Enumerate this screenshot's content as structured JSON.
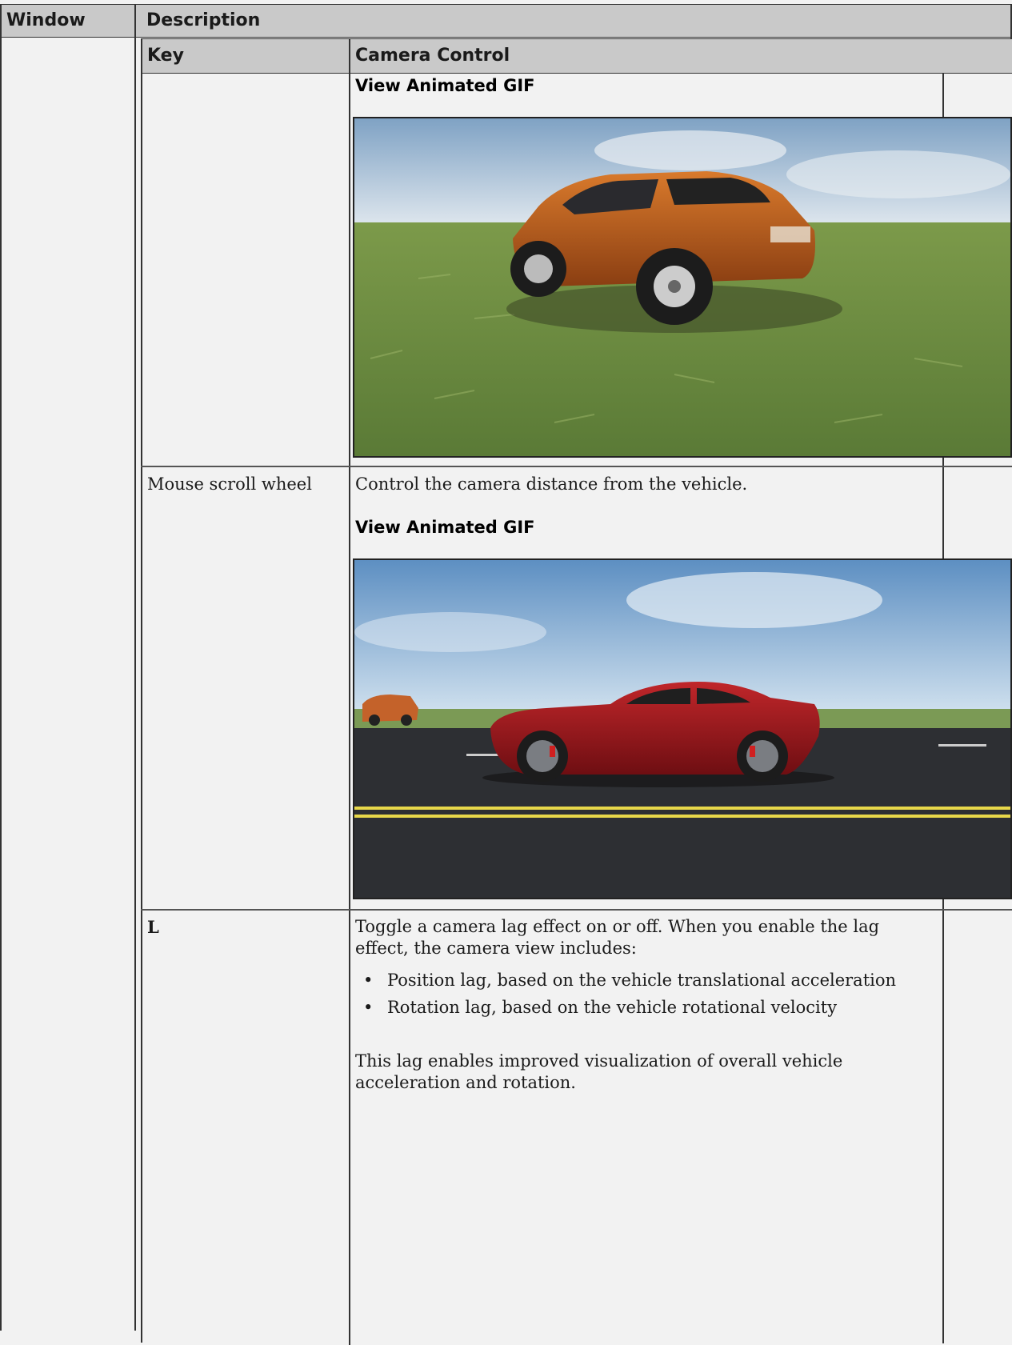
{
  "table": {
    "col_window": "Window",
    "col_description": "Description"
  },
  "inner_table": {
    "col_key": "Key",
    "col_camera_control": "Camera Control",
    "rows": [
      {
        "key": "",
        "gif_link": "View Animated GIF",
        "image_icon": "suv-on-grass-image"
      },
      {
        "key": "Mouse scroll wheel",
        "description": "Control the camera distance from the vehicle.",
        "gif_link": "View Animated GIF",
        "image_icon": "red-car-on-road-image"
      },
      {
        "key": "L",
        "description": "Toggle a camera lag effect on or off. When you enable the lag effect, the camera view includes:",
        "bullets": [
          "Position lag, based on the vehicle translational acceleration",
          "Rotation lag, based on the vehicle rotational velocity"
        ],
        "footer": "This lag enables improved visualization of overall vehicle acceleration and rotation."
      }
    ]
  },
  "colors": {
    "header_bg": "#c9c9c9",
    "page_bg": "#f2f2f2",
    "border": "#333333"
  }
}
